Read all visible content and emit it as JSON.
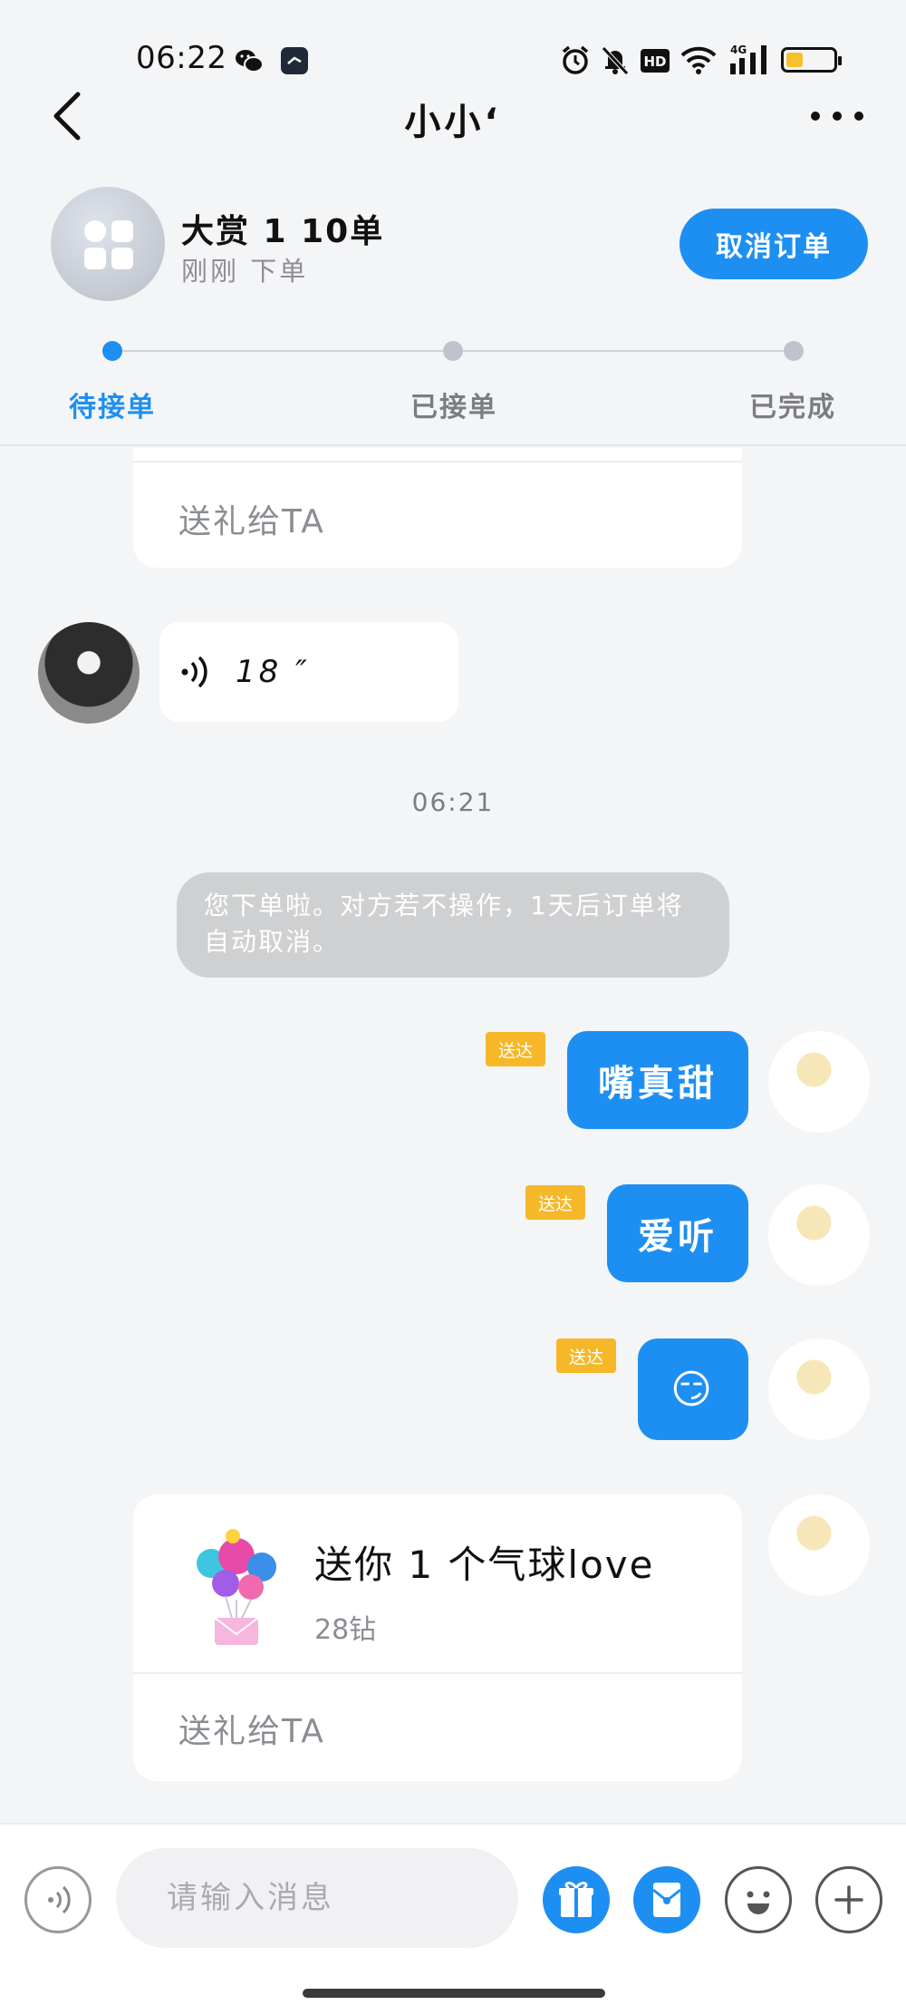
{
  "status_bar": {
    "time": "06:22",
    "left_icons": [
      "wechat-icon",
      "clock-app-icon"
    ],
    "right_icons": [
      "alarm-icon",
      "mute-icon",
      "hd-icon",
      "wifi-icon",
      "signal-4g-icon",
      "battery-icon"
    ],
    "hd_label": "HD",
    "network_label": "4G",
    "battery_color": "#f6c12b"
  },
  "header": {
    "title": "小小‘",
    "back_icon": "chevron-left-icon",
    "more_icon": "more-dots-icon"
  },
  "order": {
    "title": "大赏 1 10单",
    "subtitle": "刚刚 下单",
    "cancel_label": "取消订单"
  },
  "progress": {
    "steps": [
      {
        "label": "待接单",
        "active": true
      },
      {
        "label": "已接单",
        "active": false
      },
      {
        "label": "已完成",
        "active": false
      }
    ],
    "accent": "#1e8ff2"
  },
  "chat": {
    "partial_card": {
      "cta": "送礼给TA"
    },
    "voice_message": {
      "duration": "18 ″"
    },
    "timestamp": "06:21",
    "system_note": "您下单啦。对方若不操作，1天后订单将自动取消。",
    "messages": [
      {
        "text": "嘴真甜",
        "status": "送达"
      },
      {
        "text": "爱听",
        "status": "送达"
      },
      {
        "text": "😏",
        "status": "送达"
      }
    ],
    "gift_card": {
      "title": "送你 1 个气球love",
      "price": "28钻",
      "cta": "送礼给TA"
    }
  },
  "input_bar": {
    "placeholder": "请输入消息",
    "icons": [
      "voice-input-icon",
      "gift-icon",
      "red-packet-icon",
      "emoji-icon",
      "plus-icon"
    ]
  }
}
